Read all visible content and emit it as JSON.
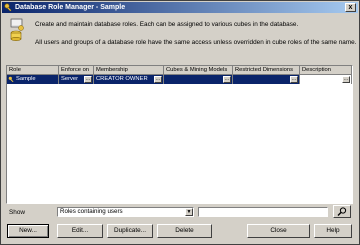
{
  "window": {
    "title": "Database Role Manager - Sample",
    "close_glyph": "x"
  },
  "description": {
    "line1": "Create and maintain database roles. Each can be assigned to various cubes in the database.",
    "line2": "All users and groups of a database role have the same access unless overridden in cube roles of the same name."
  },
  "grid": {
    "columns": [
      "Role",
      "Enforce on",
      "Membership",
      "Cubes & Mining Models",
      "Restricted Dimensions",
      "Description"
    ],
    "rows": [
      {
        "role": "Sample",
        "enforce_on": "Server",
        "membership": "CREATOR OWNER",
        "cubes": "",
        "restricted_dimensions": "",
        "description": "",
        "ellipsis": "..."
      }
    ],
    "selected_row_color": "#0a246a"
  },
  "filter": {
    "show_label": "Show",
    "show_value": "Roles containing users",
    "search_value": ""
  },
  "buttons": {
    "new": "New...",
    "edit": "Edit...",
    "duplicate": "Duplicate...",
    "delete": "Delete",
    "close": "Close",
    "help": "Help"
  },
  "icons": {
    "title": "key-icon",
    "header": "database-role-icon",
    "row": "role-key-icon",
    "search": "search-icon"
  },
  "colors": {
    "titlebar_start": "#0a246a",
    "titlebar_end": "#a6caf0",
    "face": "#d4d0c8"
  }
}
